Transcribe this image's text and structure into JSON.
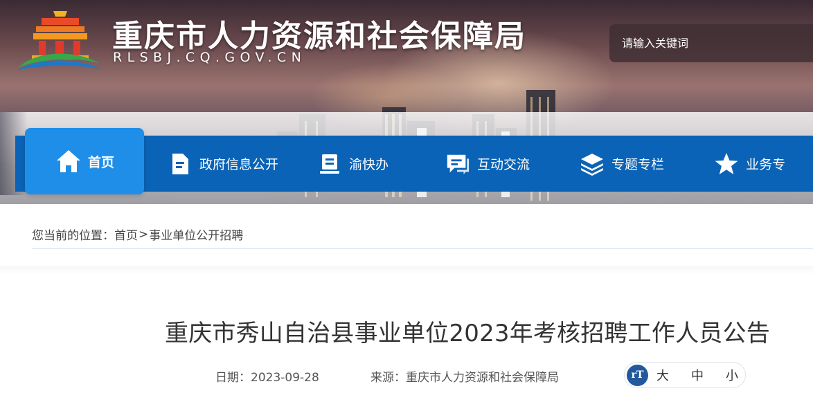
{
  "header": {
    "site_title": "重庆市人力资源和社会保障局",
    "site_domain": "RLSBJ.CQ.GOV.CN",
    "search_placeholder": "请输入关键词"
  },
  "nav": {
    "items": [
      {
        "label": "首页",
        "icon": "home-icon",
        "active": true
      },
      {
        "label": "政府信息公开",
        "icon": "document-icon"
      },
      {
        "label": "渝快办",
        "icon": "book-icon"
      },
      {
        "label": "互动交流",
        "icon": "chat-icon"
      },
      {
        "label": "专题专栏",
        "icon": "layers-icon"
      },
      {
        "label": "业务专",
        "icon": "star-icon"
      }
    ]
  },
  "breadcrumb": {
    "prefix": "您当前的位置：",
    "home": "首页",
    "separator": ">",
    "current": "事业单位公开招聘"
  },
  "article": {
    "title": "重庆市秀山自治县事业单位2023年考核招聘工作人员公告",
    "date_label": "日期：",
    "date": "2023-09-28",
    "source_label": "来源：",
    "source": "重庆市人力资源和社会保障局"
  },
  "font_size": {
    "icon_text": "rT",
    "large": "大",
    "medium": "中",
    "small": "小"
  },
  "colors": {
    "nav_bg": "#0a63b6",
    "nav_active": "#1f8ee8",
    "fs_icon": "#23599c"
  }
}
